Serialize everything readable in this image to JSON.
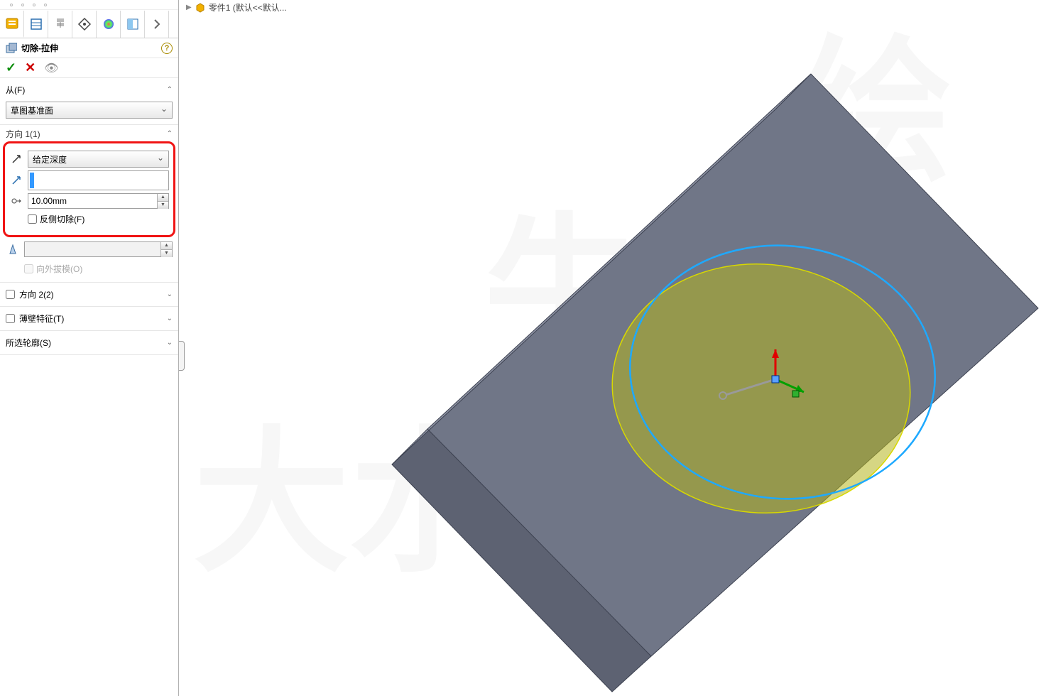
{
  "tabs": {
    "items": [
      "feature-manager",
      "property-manager",
      "config-manager",
      "dim-manager",
      "display-manager",
      "appearance-manager",
      "pane-right"
    ]
  },
  "feature": {
    "title": "切除-拉伸",
    "ok": "✓",
    "cancel": "✕",
    "eye": "👁"
  },
  "from": {
    "label": "从(F)",
    "plane": "草图基准面"
  },
  "direction1": {
    "label": "方向 1(1)",
    "end_condition": "给定深度",
    "depth": "10.00mm",
    "flip_side": "反侧切除(F)",
    "draft_out": "向外拔模(O)"
  },
  "direction2": {
    "label": "方向 2(2)"
  },
  "thin": {
    "label": "薄壁特征(T)"
  },
  "contours": {
    "label": "所选轮廓(S)"
  },
  "breadcrumb": {
    "part": "零件1  (默认<<默认..."
  },
  "watermark": {
    "a": "大水",
    "b": "牛测",
    "c": "绘"
  }
}
